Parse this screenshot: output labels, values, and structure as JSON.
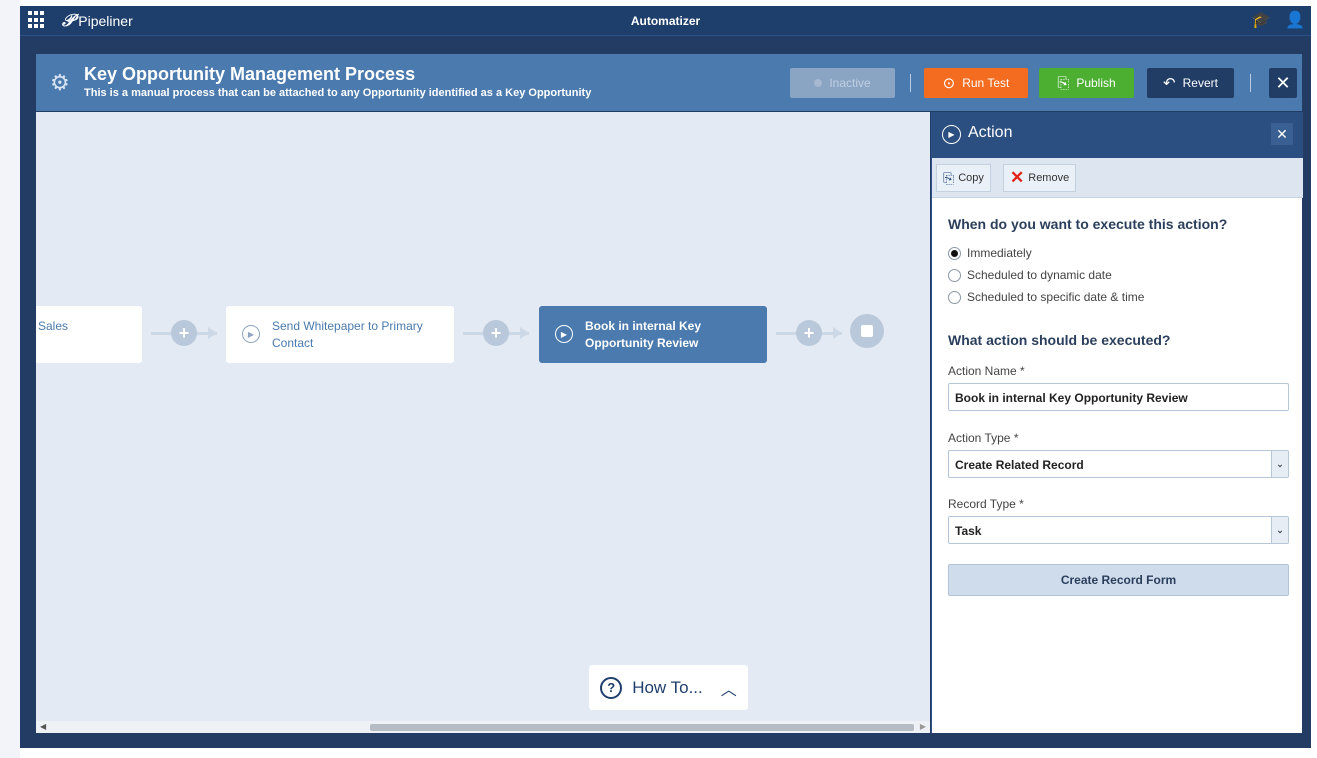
{
  "topbar": {
    "logo_text": "Pipeliner",
    "app_title": "Automatizer",
    "icons": [
      "apps-grid-icon",
      "graduation-cap-icon",
      "user-icon"
    ]
  },
  "header": {
    "title": "Key Opportunity Management Process",
    "subtitle": "This is a manual process that can be attached to any Opportunity identified as a Key Opportunity",
    "buttons": {
      "inactive": "Inactive",
      "run_test": "Run Test",
      "publish": "Publish",
      "revert": "Revert",
      "close": "✕"
    }
  },
  "canvas": {
    "nodes": [
      {
        "label": "Sales",
        "active": false
      },
      {
        "label": "Send Whitepaper to Primary Contact",
        "active": false
      },
      {
        "label": "Book in internal Key Opportunity Review",
        "active": true
      }
    ],
    "connector_symbol": "+",
    "howto": {
      "label": "How To...",
      "icon": "?",
      "chevron": "^"
    }
  },
  "panel": {
    "title": "Action",
    "close": "✕",
    "toolbar": {
      "copy": "Copy",
      "remove": "Remove"
    },
    "when_heading": "When do you want to execute this action?",
    "when_options": [
      {
        "label": "Immediately",
        "selected": true
      },
      {
        "label": "Scheduled to dynamic date",
        "selected": false
      },
      {
        "label": "Scheduled to specific date & time",
        "selected": false
      }
    ],
    "what_heading": "What action should be executed?",
    "action_name_label": "Action Name *",
    "action_name_value": "Book in internal Key Opportunity Review",
    "action_type_label": "Action Type *",
    "action_type_value": "Create Related Record",
    "record_type_label": "Record Type *",
    "record_type_value": "Task",
    "create_form_button": "Create Record Form"
  },
  "colors": {
    "topbar": "#1e3f6c",
    "header": "#4a7aae",
    "run_test": "#f36c20",
    "publish": "#4caf32",
    "revert": "#213d66",
    "active_node": "#4a7aae",
    "canvas": "#e3eaf3"
  }
}
